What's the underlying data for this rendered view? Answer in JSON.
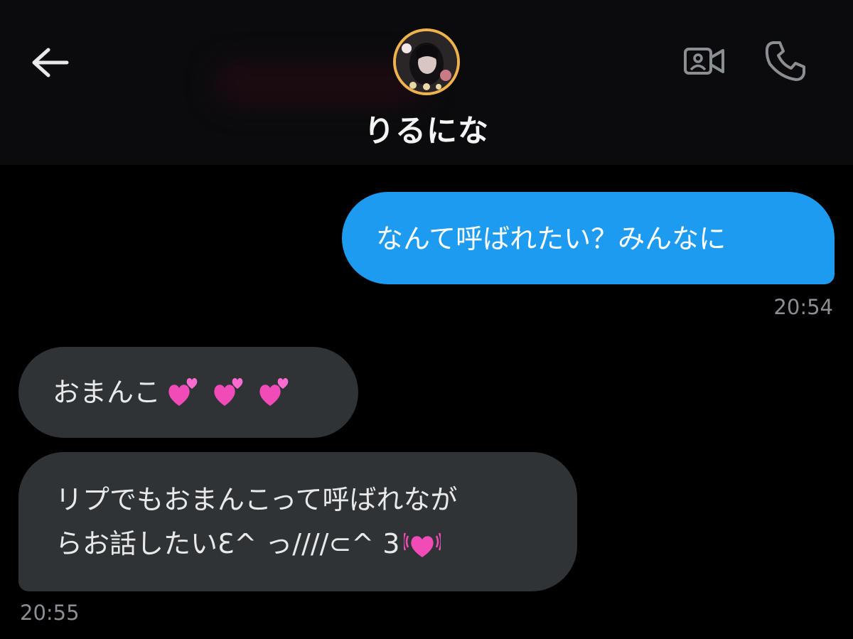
{
  "header": {
    "contact_name": "りるにな",
    "back_icon": "arrow-left-icon",
    "video_icon": "video-camera-icon",
    "call_icon": "phone-icon",
    "avatar_ring_color": "#f0b24c"
  },
  "messages": [
    {
      "direction": "outgoing",
      "text": "なんて呼ばれたい？みんなに",
      "bubble_color": "#1d9bf0"
    },
    {
      "direction": "incoming",
      "text": "おまんこ",
      "emoji": [
        "two-hearts-icon",
        "two-hearts-icon",
        "two-hearts-icon"
      ],
      "bubble_color": "#2f3336"
    },
    {
      "direction": "incoming",
      "lines": [
        "リプでもおまんこって呼ばれなが",
        "らお話したいƐ^ っ////⊂^ 3"
      ],
      "emoji": [
        "beating-heart-icon"
      ],
      "bubble_color": "#2f3336"
    }
  ],
  "timestamps": {
    "outgoing": "20:54",
    "incoming": "20:55"
  }
}
